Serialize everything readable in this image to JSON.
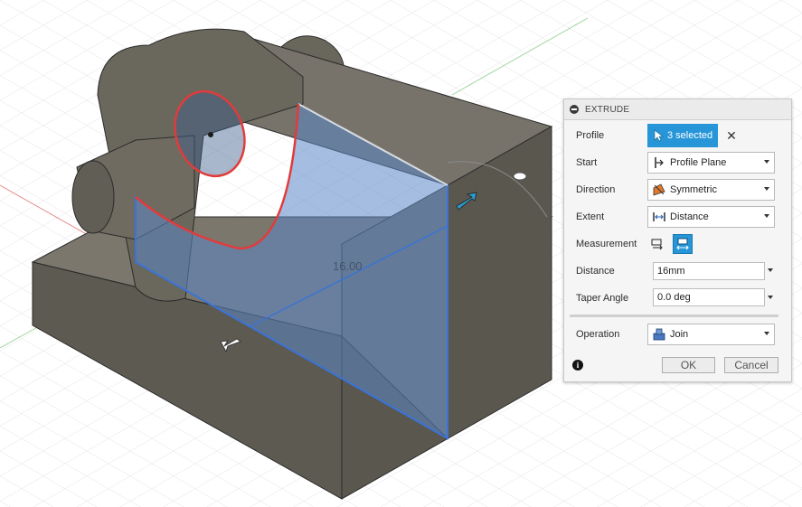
{
  "viewport": {
    "dimension_label": "16.00"
  },
  "extrude": {
    "title": "EXTRUDE",
    "profile": {
      "label": "Profile",
      "selection": "3 selected"
    },
    "start": {
      "label": "Start",
      "value": "Profile Plane"
    },
    "direction": {
      "label": "Direction",
      "value": "Symmetric"
    },
    "extent": {
      "label": "Extent",
      "value": "Distance"
    },
    "measurement": {
      "label": "Measurement"
    },
    "distance": {
      "label": "Distance",
      "value": "16mm"
    },
    "taper": {
      "label": "Taper Angle",
      "value": "0.0 deg"
    },
    "operation": {
      "label": "Operation",
      "value": "Join"
    },
    "ok_label": "OK",
    "cancel_label": "Cancel",
    "info_icon": "i"
  },
  "colors": {
    "accent": "#2696d8",
    "profile_highlight": "#e23b3b",
    "extrude_preview": "#4f7fc9",
    "model_body": "#6e6a5f"
  }
}
